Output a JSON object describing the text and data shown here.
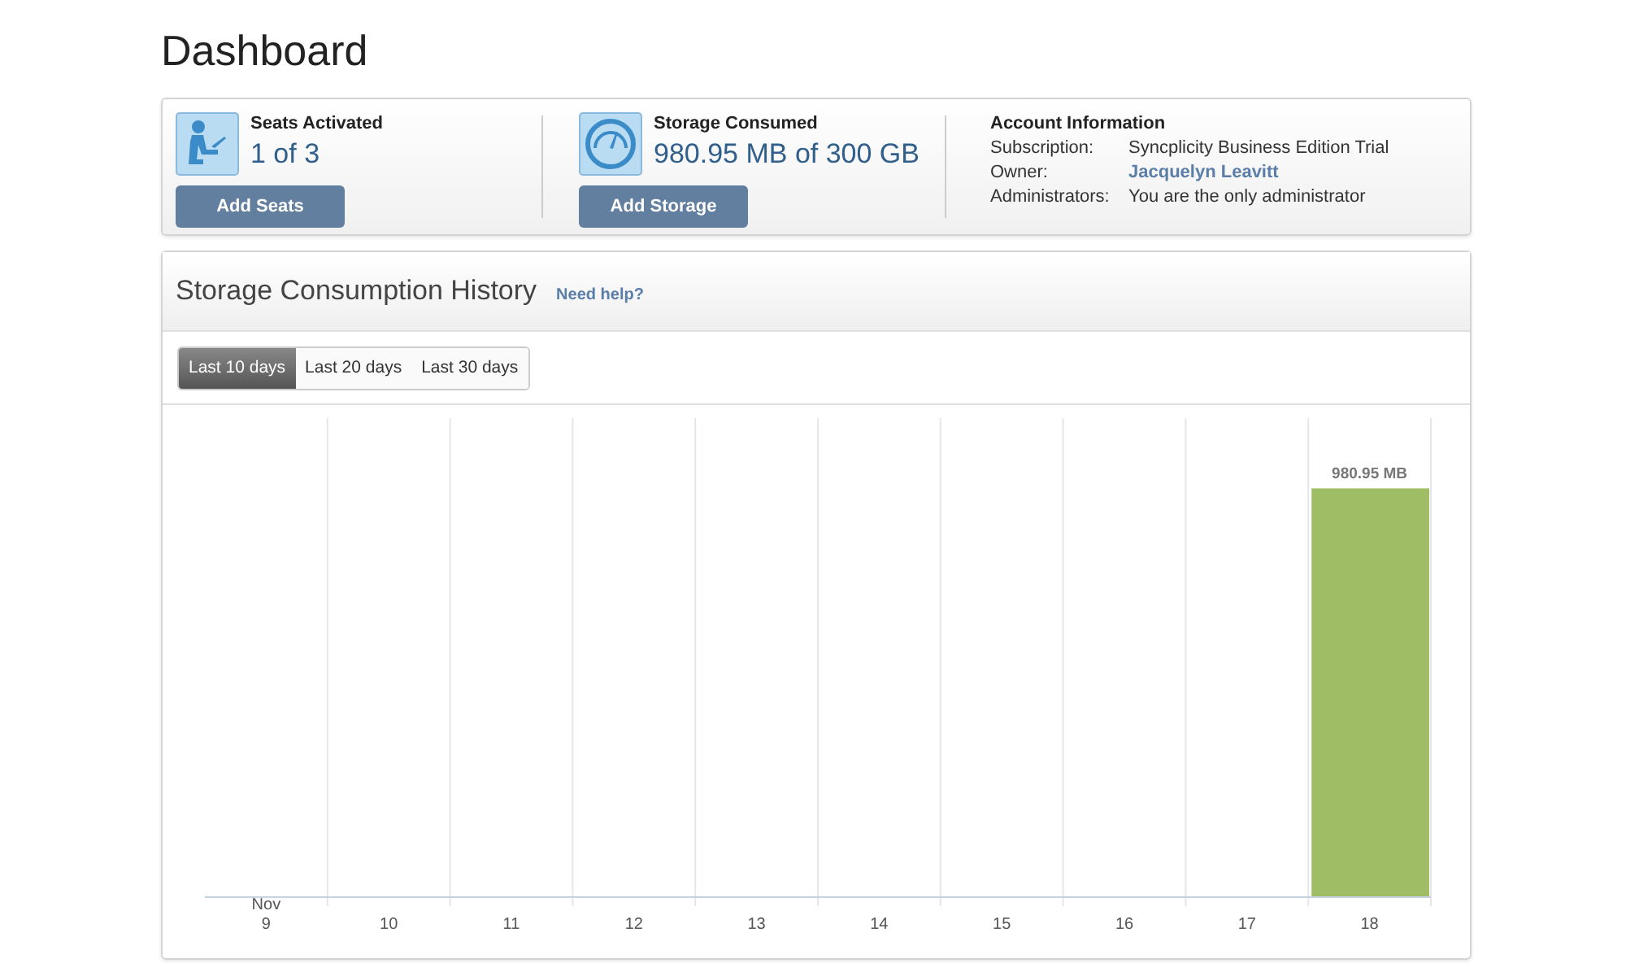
{
  "title": "Dashboard",
  "summary": {
    "stats": [
      {
        "kind": "seats",
        "label": "Seats Activated",
        "value": "1 of 3",
        "button": "Add Seats"
      },
      {
        "kind": "storage",
        "label": "Storage Consumed",
        "value": "980.95 MB of 300 GB",
        "button": "Add Storage"
      }
    ],
    "account": {
      "title": "Account Information",
      "rows": [
        {
          "label": "Subscription:",
          "value": "Syncplicity Business Edition Trial",
          "kind": "text"
        },
        {
          "label": "Owner:",
          "value": "Jacquelyn Leavitt",
          "kind": "link"
        },
        {
          "label": "Administrators:",
          "value": "You are the only administrator",
          "kind": "text"
        }
      ]
    }
  },
  "history": {
    "title": "Storage Consumption History",
    "help_link": "Need help?",
    "ranges": [
      {
        "label": "Last 10 days",
        "selected": true
      },
      {
        "label": "Last 20 days",
        "selected": false
      },
      {
        "label": "Last 30 days",
        "selected": false
      }
    ],
    "chart_data": {
      "type": "bar",
      "categories": [
        "Nov\n9",
        "10",
        "11",
        "12",
        "13",
        "14",
        "15",
        "16",
        "17",
        "18"
      ],
      "values": [
        null,
        null,
        null,
        null,
        null,
        null,
        null,
        null,
        null,
        980.95
      ],
      "value_labels": [
        null,
        null,
        null,
        null,
        null,
        null,
        null,
        null,
        null,
        "980.95 MB"
      ]
    }
  }
}
